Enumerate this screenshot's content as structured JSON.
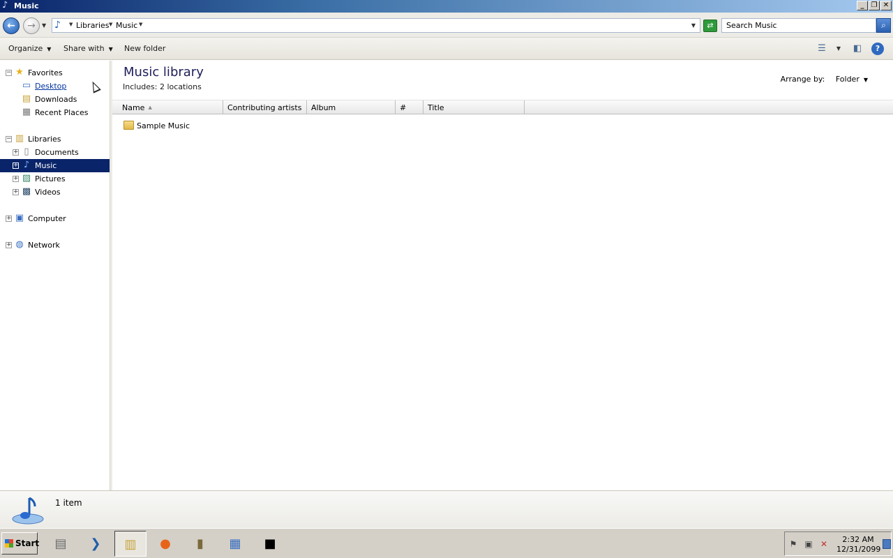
{
  "window": {
    "title": "Music",
    "minimize": "_",
    "restore": "❐",
    "close": "✕"
  },
  "address": {
    "back_icon": "back-arrow-icon",
    "breadcrumb": [
      "Libraries",
      "Music"
    ],
    "search_placeholder": "Search Music"
  },
  "toolbar": {
    "organize": "Organize",
    "share_with": "Share with",
    "new_folder": "New folder"
  },
  "nav": {
    "favorites": {
      "label": "Favorites",
      "items": [
        "Desktop",
        "Downloads",
        "Recent Places"
      ]
    },
    "libraries": {
      "label": "Libraries",
      "items": [
        "Documents",
        "Music",
        "Pictures",
        "Videos"
      ]
    },
    "computer": "Computer",
    "network": "Network"
  },
  "content": {
    "title": "Music library",
    "includes_label": "Includes:",
    "includes_link": "2 locations",
    "arrange_label": "Arrange by:",
    "arrange_value": "Folder",
    "columns": [
      "Name",
      "Contributing artists",
      "Album",
      "#",
      "Title"
    ],
    "items": [
      {
        "name": "Sample Music",
        "type": "folder"
      }
    ]
  },
  "details": {
    "count": "1 item"
  },
  "taskbar": {
    "start": "Start",
    "apps": [
      "server-manager-icon",
      "powershell-icon",
      "file-explorer-icon",
      "firefox-icon",
      "archive-tool-icon",
      "control-panel-icon",
      "command-prompt-icon"
    ],
    "clock_time": "2:32 AM",
    "clock_date": "12/31/2099"
  },
  "colors": {
    "titlebar_start": "#0a246a",
    "selection": "#0a246a",
    "link": "#0033a0"
  }
}
